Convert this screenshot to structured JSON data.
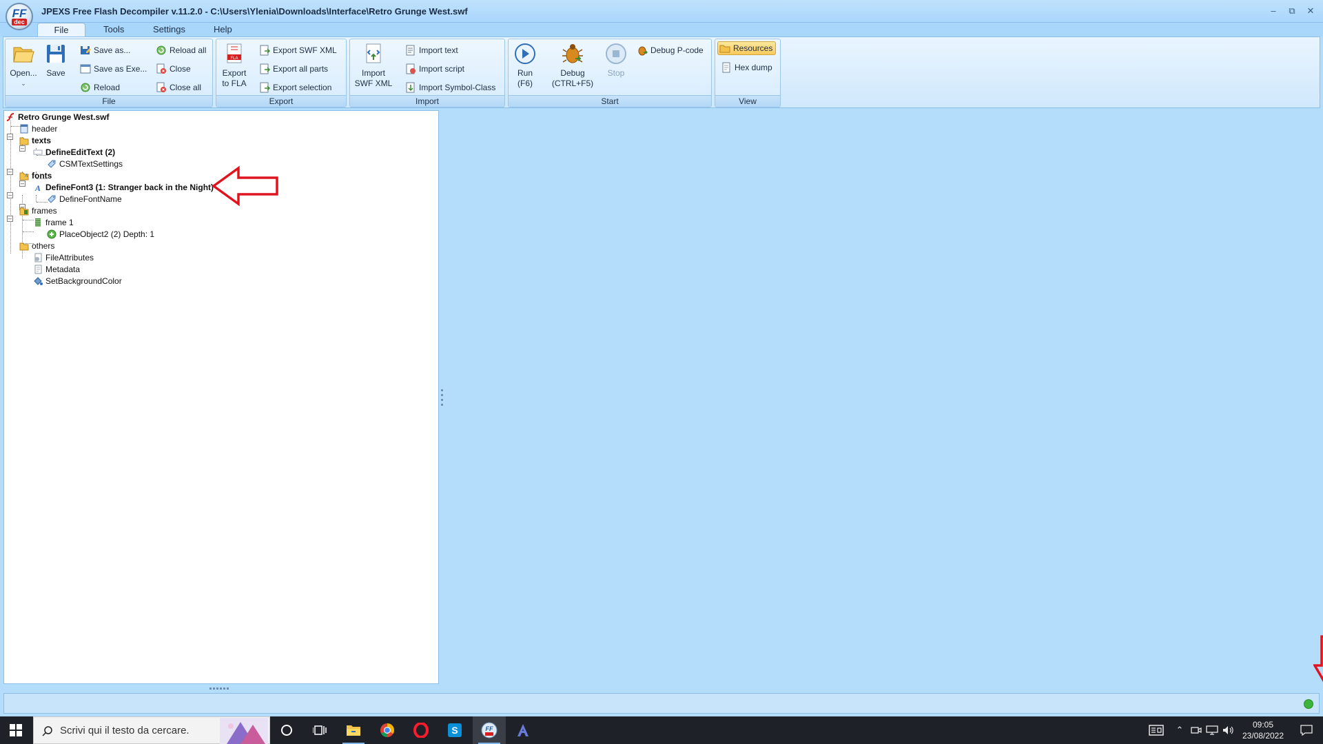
{
  "window": {
    "title": "JPEXS Free Flash Decompiler v.11.2.0 - C:\\Users\\Ylenia\\Downloads\\Interface\\Retro Grunge West.swf",
    "logo_top": "FF",
    "logo_bottom": "dec",
    "minimize": "–",
    "restore": "⧉",
    "close": "✕"
  },
  "menu": {
    "tabs": [
      "File",
      "Tools",
      "Settings",
      "Help"
    ],
    "active": "File"
  },
  "ribbon": {
    "file": {
      "label": "File",
      "open": "Open...",
      "save": "Save",
      "save_as": "Save as...",
      "save_as_exe": "Save as Exe...",
      "reload": "Reload",
      "reload_all": "Reload all",
      "close": "Close",
      "close_all": "Close all"
    },
    "export": {
      "label": "Export",
      "export_fla_line1": "Export",
      "export_fla_line2": "to FLA",
      "export_swf_xml": "Export SWF XML",
      "export_all_parts": "Export all parts",
      "export_selection": "Export selection"
    },
    "import": {
      "label": "Import",
      "import_swf_xml_line1": "Import",
      "import_swf_xml_line2": "SWF XML",
      "import_text": "Import text",
      "import_script": "Import script",
      "import_symbol_class": "Import Symbol-Class"
    },
    "start": {
      "label": "Start",
      "run_line1": "Run",
      "run_line2": "(F6)",
      "debug_line1": "Debug",
      "debug_line2": "(CTRL+F5)",
      "stop": "Stop",
      "debug_pcode": "Debug P-code"
    },
    "view": {
      "label": "View",
      "resources": "Resources",
      "hex_dump": "Hex dump"
    }
  },
  "tree": {
    "root": "Retro Grunge West.swf",
    "header": "header",
    "texts": "texts",
    "define_edit_text": "DefineEditText (2)",
    "csm_text_settings": "CSMTextSettings",
    "fonts": "fonts",
    "define_font3": "DefineFont3 (1: Stranger back in the Night)",
    "define_font_name": "DefineFontName",
    "frames": "frames",
    "frame1": "frame 1",
    "place_object2": "PlaceObject2 (2) Depth: 1",
    "others": "others",
    "file_attributes": "FileAttributes",
    "metadata": "Metadata",
    "set_background_color": "SetBackgroundColor"
  },
  "taskbar": {
    "search_placeholder": "Scrivi qui il testo da cercare.",
    "time": "09:05",
    "date": "23/08/2022"
  },
  "colors": {
    "annotation_red": "#e0141e",
    "app_background": "#b4dcfb"
  }
}
